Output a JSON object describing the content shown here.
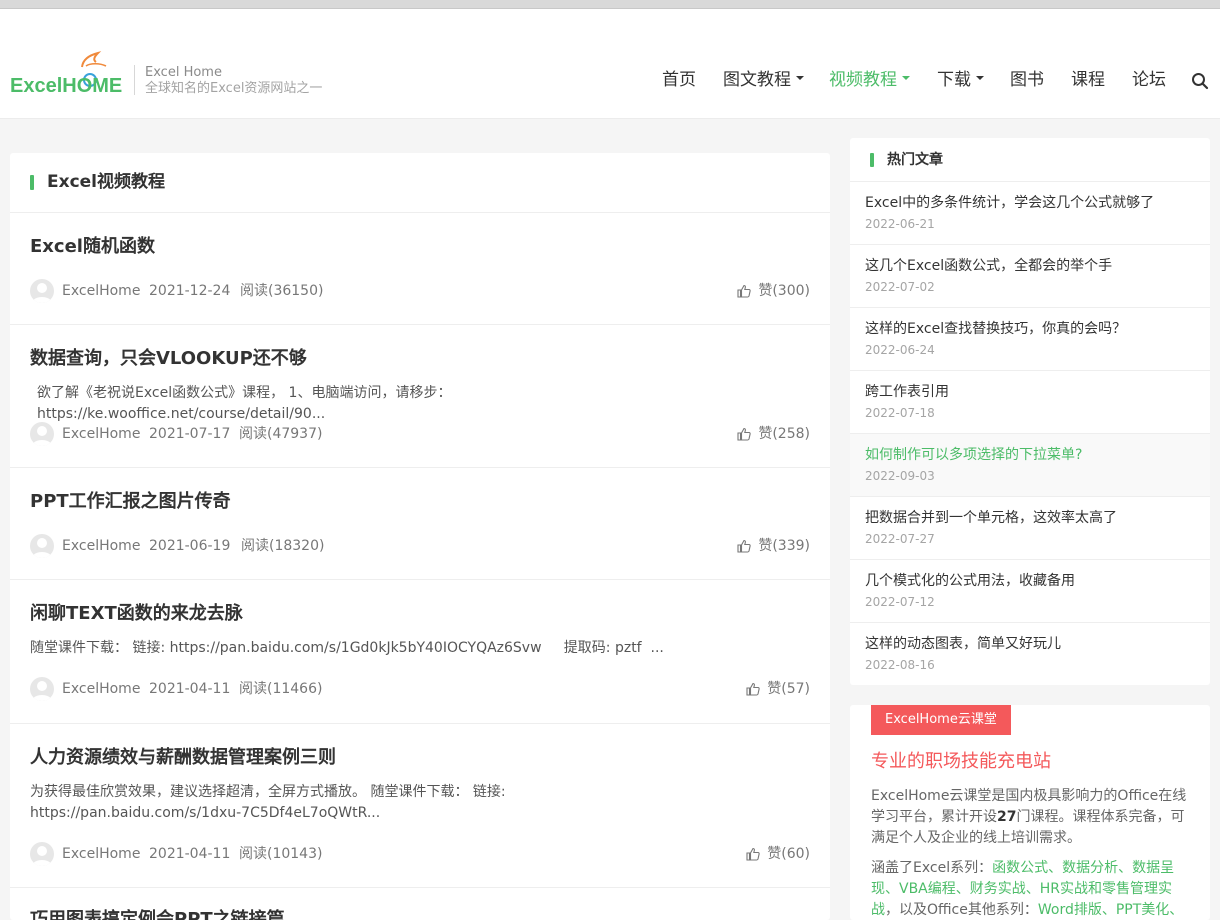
{
  "site": {
    "logo_text": "ExcelHOME",
    "name": "Excel Home",
    "tagline": "全球知名的Excel资源网站之一",
    "brand_green": "#4cbc68",
    "brand_red": "#f4595b"
  },
  "nav": {
    "items": [
      {
        "label": "首页"
      },
      {
        "label": "图文教程"
      },
      {
        "label": "视频教程"
      },
      {
        "label": "下载"
      },
      {
        "label": "图书"
      },
      {
        "label": "课程"
      },
      {
        "label": "论坛"
      }
    ],
    "active": "视频教程",
    "search_icon": "search-icon"
  },
  "main": {
    "title": "Excel视频教程",
    "articles": [
      {
        "title": "Excel随机函数",
        "excerpt": "",
        "author": "ExcelHome",
        "date": "2021-12-24",
        "views": "阅读(36150)",
        "likes": "赞(300)"
      },
      {
        "title": "数据查询，只会VLOOKUP还不够",
        "excerpt": "欲了解《老祝说Excel函数公式》课程， 1、电脑端访问，请移步：https://ke.wooffice.net/course/detail/90...",
        "author": "ExcelHome",
        "date": "2021-07-17",
        "views": "阅读(47937)",
        "likes": "赞(258)"
      },
      {
        "title": "PPT工作汇报之图片传奇",
        "excerpt": "",
        "author": "ExcelHome",
        "date": "2021-06-19",
        "views": "阅读(18320)",
        "likes": "赞(339)"
      },
      {
        "title": "闲聊TEXT函数的来龙去脉",
        "excerpt": "随堂课件下载： 链接: https://pan.baidu.com/s/1Gd0kJk5bY40IOCYQAz6Svw     提取码: pztf  ...",
        "author": "ExcelHome",
        "date": "2021-04-11",
        "views": "阅读(11466)",
        "likes": "赞(57)"
      },
      {
        "title": "人力资源绩效与薪酬数据管理案例三则",
        "excerpt": "为获得最佳欣赏效果，建议选择超清，全屏方式播放。 随堂课件下载： 链接: https://pan.baidu.com/s/1dxu-7C5Df4eL7oQWtR...",
        "author": "ExcelHome",
        "date": "2021-04-11",
        "views": "阅读(10143)",
        "likes": "赞(60)"
      },
      {
        "title": "巧用图表搞定例会PPT之链接篇",
        "excerpt": "",
        "author": "",
        "date": "",
        "views": "",
        "likes": ""
      }
    ]
  },
  "hot": {
    "title": "热门文章",
    "items": [
      {
        "title": "Excel中的多条件统计，学会这几个公式就够了",
        "date": "2022-06-21"
      },
      {
        "title": "这几个Excel函数公式，全都会的举个手",
        "date": "2022-07-02"
      },
      {
        "title": "这样的Excel查找替换技巧，你真的会吗？",
        "date": "2022-06-24"
      },
      {
        "title": "跨工作表引用",
        "date": "2022-07-18"
      },
      {
        "title": "如何制作可以多项选择的下拉菜单?",
        "date": "2022-09-03"
      },
      {
        "title": "把数据合并到一个单元格，这效率太高了",
        "date": "2022-07-27"
      },
      {
        "title": "几个模式化的公式用法，收藏备用",
        "date": "2022-07-12"
      },
      {
        "title": "这样的动态图表，简单又好玩儿",
        "date": "2022-08-16"
      }
    ]
  },
  "promo": {
    "badge": "ExcelHome云课堂",
    "title": "专业的职场技能充电站",
    "desc_before": "ExcelHome云课堂是国内极具影响力的Office在线学习平台，累计开设",
    "desc_count": "27",
    "desc_after": "门课程。课程体系完备，可满足个人及企业的线上培训需求。",
    "topics_before": "涵盖了Excel系列：",
    "topics_excel": "函数公式、数据分析、数据呈现、VBA编程、财务实战、HR实战和零售管理实战",
    "topics_mid": "，以及Office其他系列：",
    "topics_office": "Word排版、PPT美化、"
  }
}
